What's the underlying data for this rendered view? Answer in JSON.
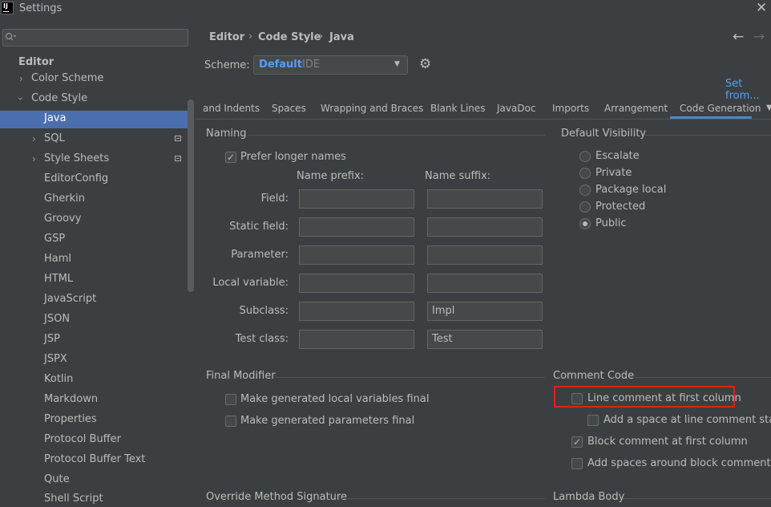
{
  "window": {
    "title": "Settings",
    "logo": "IJ"
  },
  "search": {
    "placeholder": ""
  },
  "tree": {
    "editor": "Editor",
    "color_scheme": "Color Scheme",
    "code_style": "Code Style",
    "items": [
      "Java",
      "SQL",
      "Style Sheets",
      "EditorConfig",
      "Gherkin",
      "Groovy",
      "GSP",
      "Haml",
      "HTML",
      "JavaScript",
      "JSON",
      "JSP",
      "JSPX",
      "Kotlin",
      "Markdown",
      "Properties",
      "Protocol Buffer",
      "Protocol Buffer Text",
      "Qute",
      "Shell Script"
    ],
    "selected": "Java"
  },
  "breadcrumb": [
    "Editor",
    "Code Style",
    "Java"
  ],
  "scheme": {
    "label": "Scheme:",
    "name": "Default",
    "type": "IDE"
  },
  "set_from": "Set from...",
  "tabs": [
    "and Indents",
    "Spaces",
    "Wrapping and Braces",
    "Blank Lines",
    "JavaDoc",
    "Imports",
    "Arrangement",
    "Code Generation"
  ],
  "active_tab": "Code Generation",
  "naming": {
    "title": "Naming",
    "prefer_longer": {
      "label": "Prefer longer names",
      "checked": true
    },
    "prefix_header": "Name prefix:",
    "suffix_header": "Name suffix:",
    "rows": [
      {
        "label": "Field:",
        "prefix": "",
        "suffix": ""
      },
      {
        "label": "Static field:",
        "prefix": "",
        "suffix": ""
      },
      {
        "label": "Parameter:",
        "prefix": "",
        "suffix": ""
      },
      {
        "label": "Local variable:",
        "prefix": "",
        "suffix": ""
      },
      {
        "label": "Subclass:",
        "prefix": "",
        "suffix": "Impl"
      },
      {
        "label": "Test class:",
        "prefix": "",
        "suffix": "Test"
      }
    ]
  },
  "visibility": {
    "title": "Default Visibility",
    "options": [
      "Escalate",
      "Private",
      "Package local",
      "Protected",
      "Public"
    ],
    "selected": "Public"
  },
  "final_modifier": {
    "title": "Final Modifier",
    "local_vars": {
      "label": "Make generated local variables final",
      "checked": false
    },
    "params": {
      "label": "Make generated parameters final",
      "checked": false
    }
  },
  "comment_code": {
    "title": "Comment Code",
    "line_first_col": {
      "label": "Line comment at first column",
      "checked": false
    },
    "add_space": {
      "label": "Add a space at line comment start",
      "checked": false
    },
    "block_first_col": {
      "label": "Block comment at first column",
      "checked": true
    },
    "spaces_around": {
      "label": "Add spaces around block comments",
      "checked": false
    }
  },
  "override_title": "Override Method Signature",
  "lambda_title": "Lambda Body",
  "colors": {
    "accent": "#4b6eaf",
    "link": "#589df6",
    "highlight": "#e02020"
  }
}
